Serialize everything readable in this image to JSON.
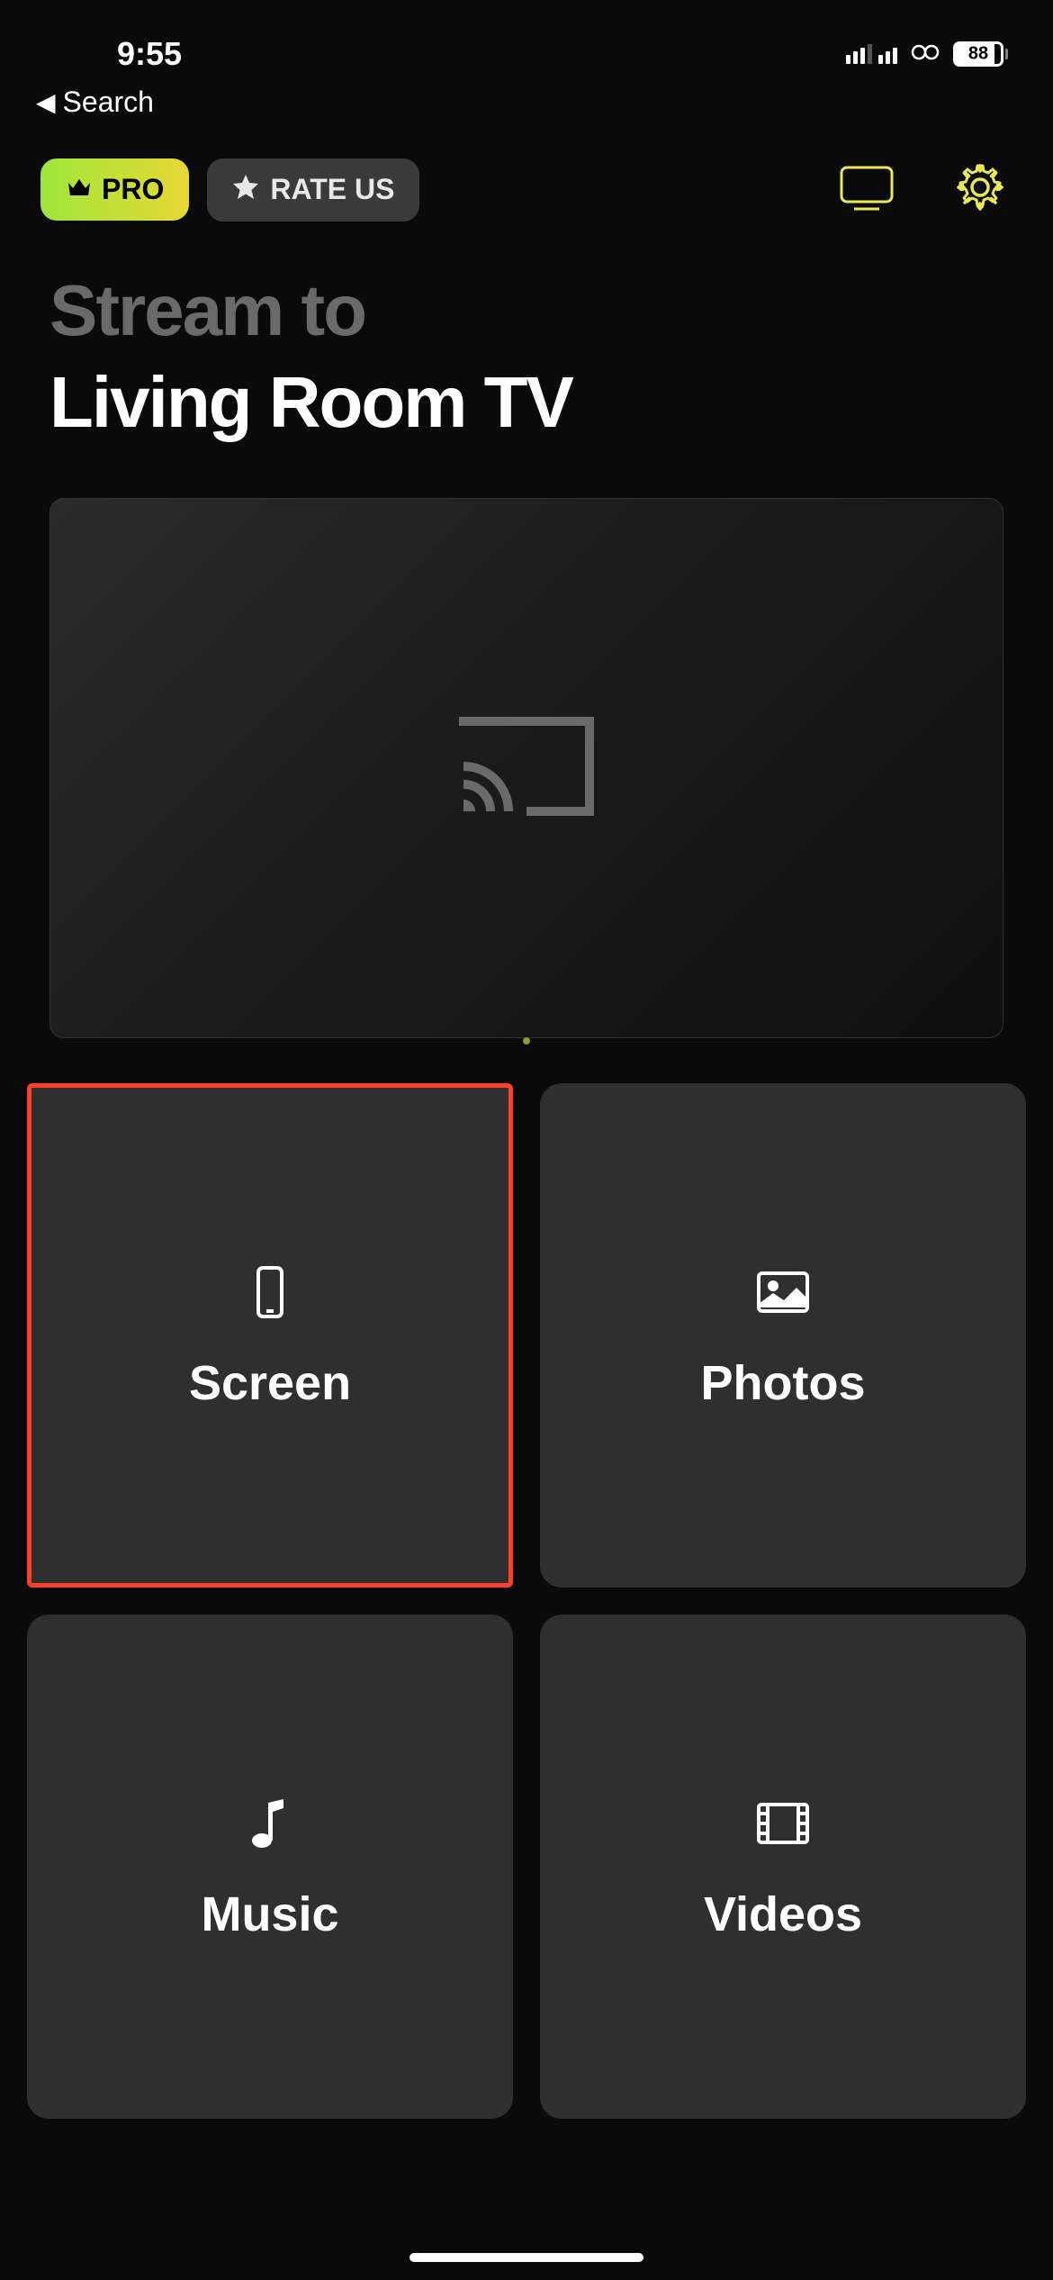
{
  "statusBar": {
    "time": "9:55",
    "battery": "88"
  },
  "backNav": {
    "label": "Search"
  },
  "toolbar": {
    "proLabel": "PRO",
    "rateLabel": "RATE US"
  },
  "header": {
    "streamTo": "Stream to",
    "deviceName": "Living Room TV"
  },
  "tiles": [
    {
      "id": "screen",
      "label": "Screen",
      "selected": true
    },
    {
      "id": "photos",
      "label": "Photos",
      "selected": false
    },
    {
      "id": "music",
      "label": "Music",
      "selected": false
    },
    {
      "id": "videos",
      "label": "Videos",
      "selected": false
    }
  ]
}
